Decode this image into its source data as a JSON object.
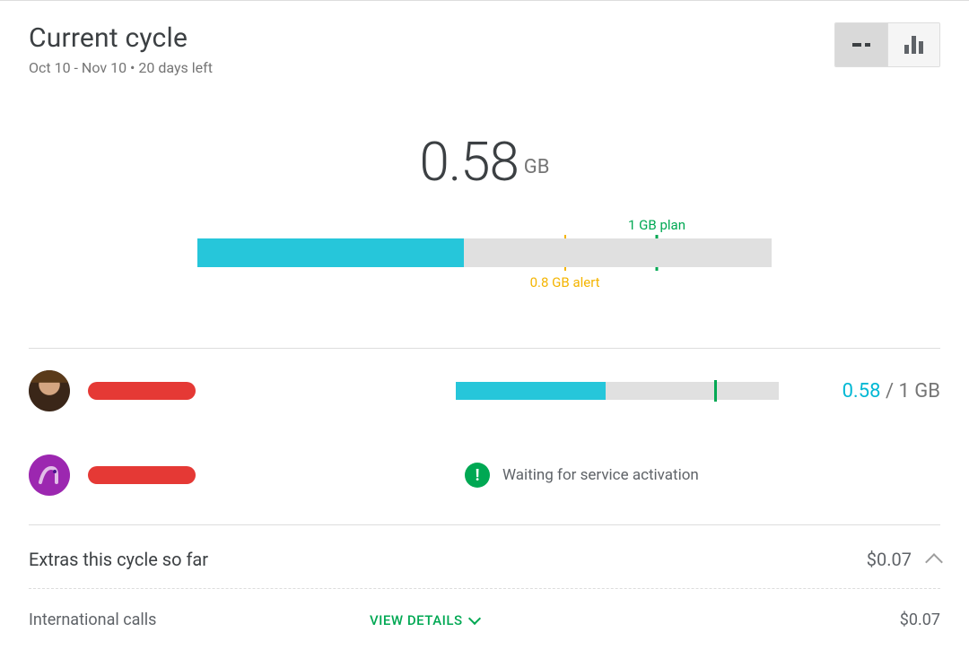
{
  "header": {
    "title": "Current cycle",
    "subtitle": "Oct 10 - Nov 10 • 20 days left"
  },
  "chart_data": {
    "type": "bar",
    "total_used": 0.58,
    "total_unit": "GB",
    "plan_gb": 1,
    "alert_gb": 0.8,
    "bar_max_gb": 1.25,
    "plan_label": "1 GB plan",
    "alert_label": "0.8 GB alert"
  },
  "users": [
    {
      "avatar": "pirate",
      "used_gb": 0.58,
      "plan_gb": 1,
      "used_label": "0.58",
      "plan_label": "1 GB"
    },
    {
      "avatar": "purple",
      "status": "Waiting for service activation"
    }
  ],
  "extras": {
    "title": "Extras this cycle so far",
    "amount": "$0.07",
    "rows": [
      {
        "label": "International calls",
        "view_details": "VIEW DETAILS",
        "amount": "$0.07"
      }
    ]
  }
}
